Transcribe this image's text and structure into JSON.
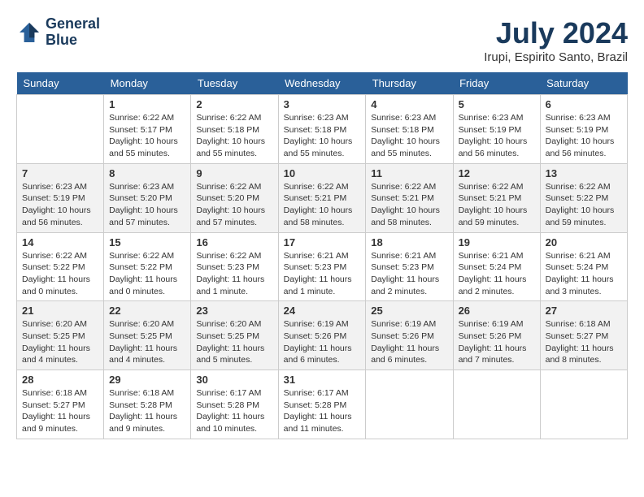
{
  "header": {
    "logo_line1": "General",
    "logo_line2": "Blue",
    "month_title": "July 2024",
    "location": "Irupi, Espirito Santo, Brazil"
  },
  "days_of_week": [
    "Sunday",
    "Monday",
    "Tuesday",
    "Wednesday",
    "Thursday",
    "Friday",
    "Saturday"
  ],
  "weeks": [
    [
      {
        "num": "",
        "info": ""
      },
      {
        "num": "1",
        "info": "Sunrise: 6:22 AM\nSunset: 5:17 PM\nDaylight: 10 hours\nand 55 minutes."
      },
      {
        "num": "2",
        "info": "Sunrise: 6:22 AM\nSunset: 5:18 PM\nDaylight: 10 hours\nand 55 minutes."
      },
      {
        "num": "3",
        "info": "Sunrise: 6:23 AM\nSunset: 5:18 PM\nDaylight: 10 hours\nand 55 minutes."
      },
      {
        "num": "4",
        "info": "Sunrise: 6:23 AM\nSunset: 5:18 PM\nDaylight: 10 hours\nand 55 minutes."
      },
      {
        "num": "5",
        "info": "Sunrise: 6:23 AM\nSunset: 5:19 PM\nDaylight: 10 hours\nand 56 minutes."
      },
      {
        "num": "6",
        "info": "Sunrise: 6:23 AM\nSunset: 5:19 PM\nDaylight: 10 hours\nand 56 minutes."
      }
    ],
    [
      {
        "num": "7",
        "info": "Sunrise: 6:23 AM\nSunset: 5:19 PM\nDaylight: 10 hours\nand 56 minutes."
      },
      {
        "num": "8",
        "info": "Sunrise: 6:23 AM\nSunset: 5:20 PM\nDaylight: 10 hours\nand 57 minutes."
      },
      {
        "num": "9",
        "info": "Sunrise: 6:22 AM\nSunset: 5:20 PM\nDaylight: 10 hours\nand 57 minutes."
      },
      {
        "num": "10",
        "info": "Sunrise: 6:22 AM\nSunset: 5:21 PM\nDaylight: 10 hours\nand 58 minutes."
      },
      {
        "num": "11",
        "info": "Sunrise: 6:22 AM\nSunset: 5:21 PM\nDaylight: 10 hours\nand 58 minutes."
      },
      {
        "num": "12",
        "info": "Sunrise: 6:22 AM\nSunset: 5:21 PM\nDaylight: 10 hours\nand 59 minutes."
      },
      {
        "num": "13",
        "info": "Sunrise: 6:22 AM\nSunset: 5:22 PM\nDaylight: 10 hours\nand 59 minutes."
      }
    ],
    [
      {
        "num": "14",
        "info": "Sunrise: 6:22 AM\nSunset: 5:22 PM\nDaylight: 11 hours\nand 0 minutes."
      },
      {
        "num": "15",
        "info": "Sunrise: 6:22 AM\nSunset: 5:22 PM\nDaylight: 11 hours\nand 0 minutes."
      },
      {
        "num": "16",
        "info": "Sunrise: 6:22 AM\nSunset: 5:23 PM\nDaylight: 11 hours\nand 1 minute."
      },
      {
        "num": "17",
        "info": "Sunrise: 6:21 AM\nSunset: 5:23 PM\nDaylight: 11 hours\nand 1 minute."
      },
      {
        "num": "18",
        "info": "Sunrise: 6:21 AM\nSunset: 5:23 PM\nDaylight: 11 hours\nand 2 minutes."
      },
      {
        "num": "19",
        "info": "Sunrise: 6:21 AM\nSunset: 5:24 PM\nDaylight: 11 hours\nand 2 minutes."
      },
      {
        "num": "20",
        "info": "Sunrise: 6:21 AM\nSunset: 5:24 PM\nDaylight: 11 hours\nand 3 minutes."
      }
    ],
    [
      {
        "num": "21",
        "info": "Sunrise: 6:20 AM\nSunset: 5:25 PM\nDaylight: 11 hours\nand 4 minutes."
      },
      {
        "num": "22",
        "info": "Sunrise: 6:20 AM\nSunset: 5:25 PM\nDaylight: 11 hours\nand 4 minutes."
      },
      {
        "num": "23",
        "info": "Sunrise: 6:20 AM\nSunset: 5:25 PM\nDaylight: 11 hours\nand 5 minutes."
      },
      {
        "num": "24",
        "info": "Sunrise: 6:19 AM\nSunset: 5:26 PM\nDaylight: 11 hours\nand 6 minutes."
      },
      {
        "num": "25",
        "info": "Sunrise: 6:19 AM\nSunset: 5:26 PM\nDaylight: 11 hours\nand 6 minutes."
      },
      {
        "num": "26",
        "info": "Sunrise: 6:19 AM\nSunset: 5:26 PM\nDaylight: 11 hours\nand 7 minutes."
      },
      {
        "num": "27",
        "info": "Sunrise: 6:18 AM\nSunset: 5:27 PM\nDaylight: 11 hours\nand 8 minutes."
      }
    ],
    [
      {
        "num": "28",
        "info": "Sunrise: 6:18 AM\nSunset: 5:27 PM\nDaylight: 11 hours\nand 9 minutes."
      },
      {
        "num": "29",
        "info": "Sunrise: 6:18 AM\nSunset: 5:28 PM\nDaylight: 11 hours\nand 9 minutes."
      },
      {
        "num": "30",
        "info": "Sunrise: 6:17 AM\nSunset: 5:28 PM\nDaylight: 11 hours\nand 10 minutes."
      },
      {
        "num": "31",
        "info": "Sunrise: 6:17 AM\nSunset: 5:28 PM\nDaylight: 11 hours\nand 11 minutes."
      },
      {
        "num": "",
        "info": ""
      },
      {
        "num": "",
        "info": ""
      },
      {
        "num": "",
        "info": ""
      }
    ]
  ]
}
